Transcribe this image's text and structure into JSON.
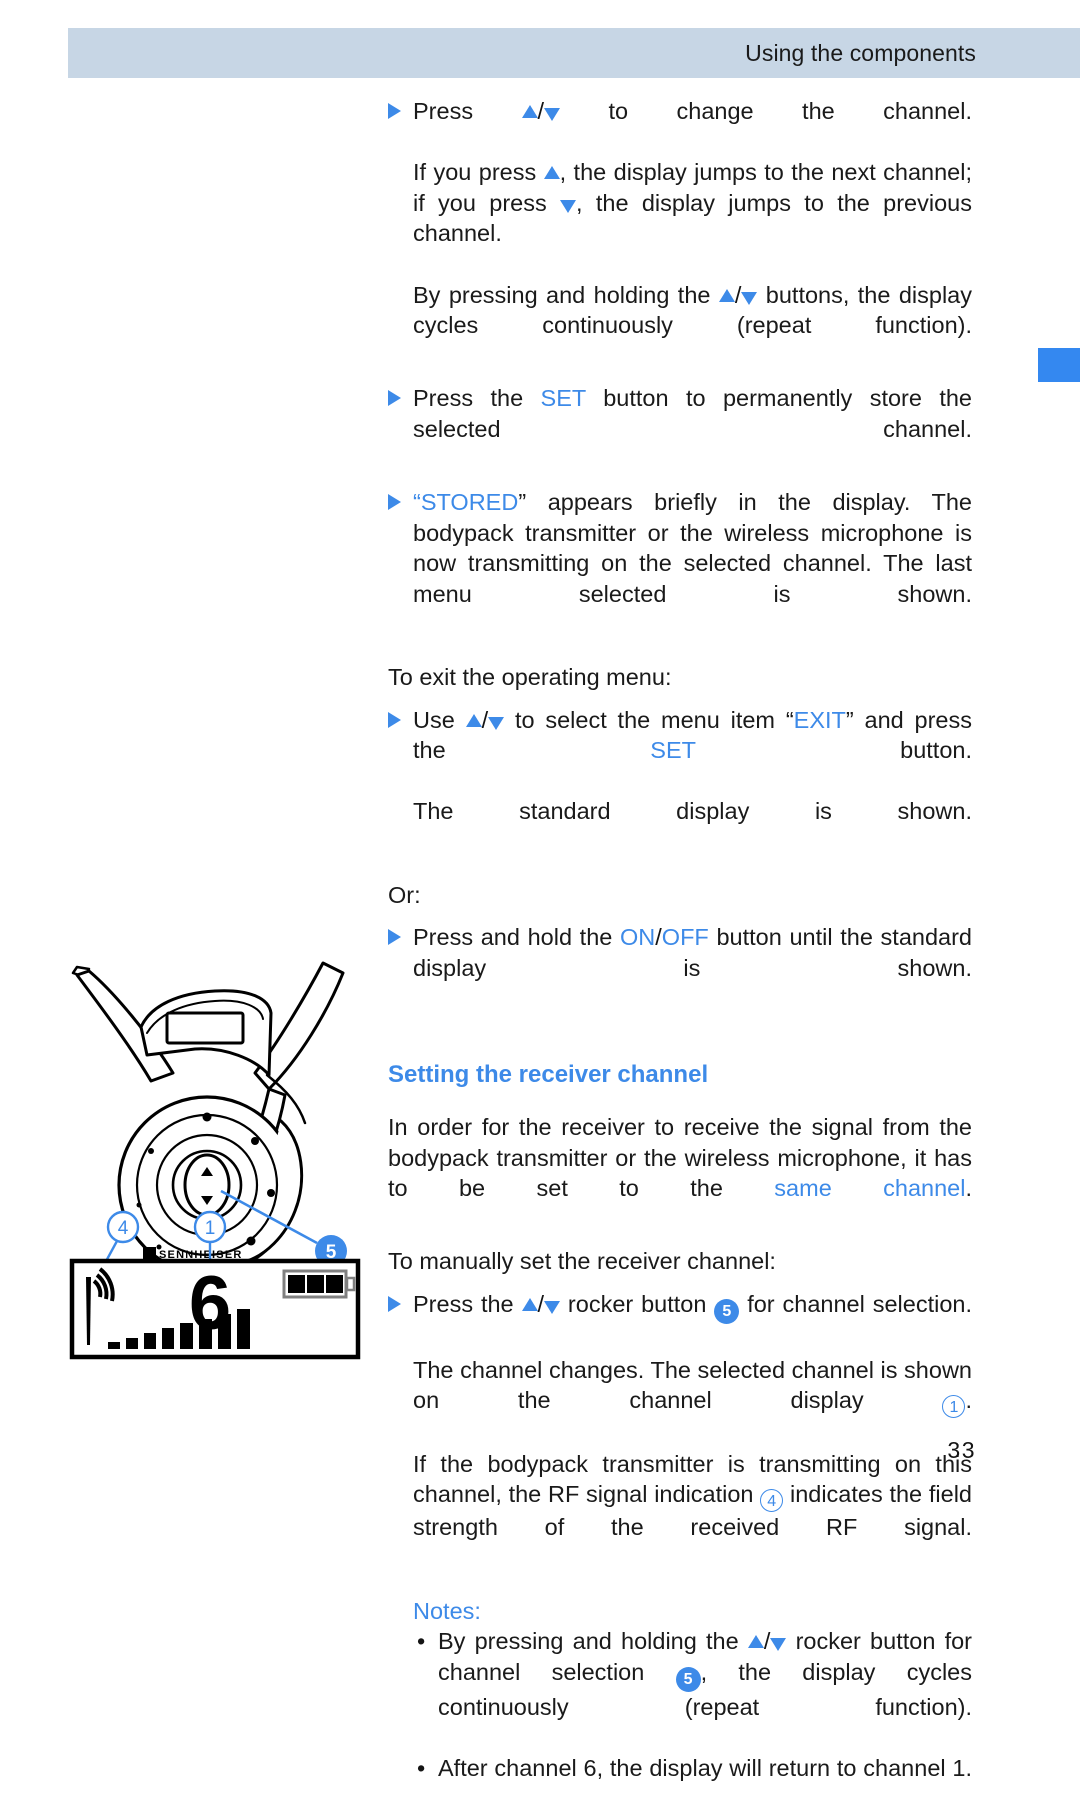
{
  "page": {
    "number": "33",
    "header_title": "Using the components",
    "colors": {
      "accent_blue": "#3d8ae8",
      "header_band": "#c7d6e5",
      "edge_tab": "#3488f0",
      "text": "#141414"
    }
  },
  "body": {
    "b1": {
      "lead": "Press ",
      "after_arrows": " to change the channel.",
      "line2a": "If you press ",
      "line2b": ", the display jumps to the next channel; if you press ",
      "line2c": ", the display jumps to the previous channel.",
      "line3a": "By pressing and holding the ",
      "line3b": " buttons, the display cycles continuously (repeat function)."
    },
    "b2": {
      "pre": "Press the ",
      "key": "SET",
      "post": " button to permanently store the selected channel."
    },
    "b3": {
      "open_quote": "“",
      "key": "STORED",
      "close_quote": "”",
      "post": " appears briefly in the display. The bodypack transmitter or the wireless microphone is now transmitting on the selected channel. The last menu selected is shown."
    },
    "exit_intro": "To exit the operating menu:",
    "b4": {
      "pre": "Use ",
      "mid": " to select the menu item ",
      "open_quote": "“",
      "key_exit": "EXIT",
      "close_quote": "”",
      "mid2": " and press the ",
      "key_set": "SET",
      "post": " button."
    },
    "b4_follow": "The standard display is shown.",
    "or_label": "Or:",
    "b5": {
      "pre": "Press and hold the ",
      "key_on": "ON",
      "slash": "/",
      "key_off": "OFF",
      "post": " button until the standard display is shown."
    },
    "heading": "Setting the receiver channel",
    "intro": {
      "pre": "In order for the receiver to receive the signal from the bodypack transmitter or the wireless microphone, it has to be set to the ",
      "link": "same channel",
      "post": "."
    },
    "manual_intro": "To manually set the receiver channel:",
    "b6": {
      "pre": "Press the ",
      "mid": " rocker button ",
      "badge": "5",
      "post": " for channel selection."
    },
    "b6_follow": {
      "pre": "The channel changes. The selected channel is shown on the channel display ",
      "badge": "1",
      "post": "."
    },
    "b6_follow2": {
      "pre": "If the bodypack transmitter is transmitting on this channel, the RF signal indication ",
      "badge": "4",
      "post": " indicates the field strength of the received RF signal."
    },
    "notes_label": "Notes:",
    "notes": [
      {
        "pre": "By pressing and holding the ",
        "mid": " rocker button for channel selection ",
        "badge": "5",
        "post": ", the display cycles continuously (repeat function)."
      },
      {
        "text": "After channel 6, the display will return to channel 1."
      }
    ]
  },
  "figure": {
    "brand_label": "SENNHEISER",
    "callouts": [
      {
        "id": "5",
        "style": "filled",
        "target": "rocker-button"
      },
      {
        "id": "4",
        "style": "outline",
        "target": "rf-signal-indication"
      },
      {
        "id": "1",
        "style": "outline",
        "target": "channel-display"
      }
    ],
    "display": {
      "channel_number": "6",
      "battery_segments": 3,
      "af_bar_count": 8,
      "rf_arcs": 3
    }
  }
}
